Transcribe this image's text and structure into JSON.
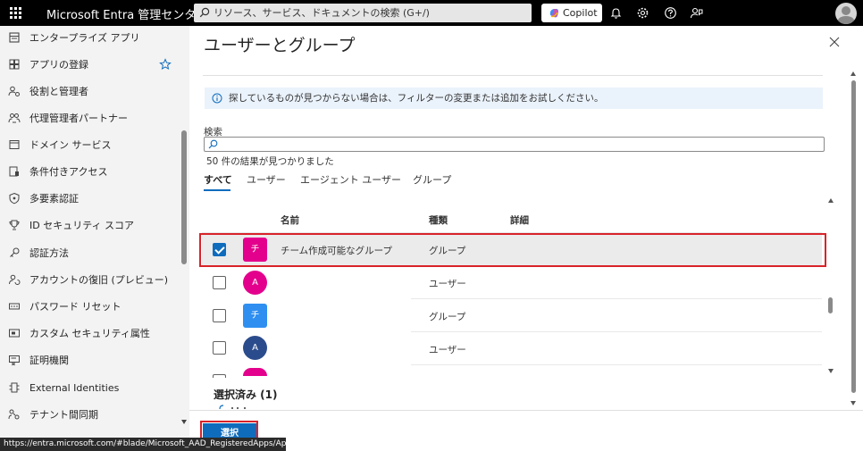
{
  "topbar": {
    "brand": "Microsoft Entra 管理センター",
    "search_placeholder": "リソース、サービス、ドキュメントの検索 (G+/)",
    "copilot_label": "Copilot"
  },
  "sidebar": {
    "items": [
      {
        "label": "エンタープライズ アプリ",
        "icon": "grid-icon"
      },
      {
        "label": "アプリの登録",
        "icon": "app-registration-icon"
      },
      {
        "label": "役割と管理者",
        "icon": "roles-icon"
      },
      {
        "label": "代理管理者パートナー",
        "icon": "partner-icon"
      },
      {
        "label": "ドメイン サービス",
        "icon": "domain-icon"
      },
      {
        "label": "条件付きアクセス",
        "icon": "conditional-access-icon"
      },
      {
        "label": "多要素認証",
        "icon": "shield-icon"
      },
      {
        "label": "ID セキュリティ スコア",
        "icon": "trophy-icon"
      },
      {
        "label": "認証方法",
        "icon": "key-icon"
      },
      {
        "label": "アカウントの復旧 (プレビュー)",
        "icon": "account-recovery-icon"
      },
      {
        "label": "パスワード リセット",
        "icon": "password-icon"
      },
      {
        "label": "カスタム セキュリティ属性",
        "icon": "attributes-icon"
      },
      {
        "label": "証明機関",
        "icon": "certificate-icon"
      },
      {
        "label": "External Identities",
        "icon": "external-identities-icon"
      },
      {
        "label": "テナント間同期",
        "icon": "sync-icon"
      }
    ]
  },
  "panel": {
    "title": "ユーザーとグループ",
    "info_text": "探しているものが見つからない場合は、フィルターの変更または追加をお試しください。",
    "search_label": "検索",
    "search_value": "",
    "result_count": "50 件の結果が見つかりました",
    "tabs": [
      {
        "label": "すべて",
        "active": true
      },
      {
        "label": "ユーザー",
        "active": false
      },
      {
        "label": "エージェント ユーザー",
        "active": false
      },
      {
        "label": "グループ",
        "active": false
      }
    ],
    "columns": [
      "名前",
      "種類",
      "詳細"
    ],
    "rows": [
      {
        "initial": "チ",
        "name": "チーム作成可能なグループ",
        "type": "グループ",
        "checked": true,
        "color": "#e3008c"
      },
      {
        "initial": "A",
        "name": "",
        "type": "ユーザー",
        "checked": false,
        "color": "#e3008c"
      },
      {
        "initial": "チ",
        "name": "",
        "type": "グループ",
        "checked": false,
        "color": "#2f8ff0"
      },
      {
        "initial": "A",
        "name": "",
        "type": "ユーザー",
        "checked": false,
        "color": "#2b4c8c"
      }
    ],
    "selected_title": "選択済み (1)",
    "select_button": "選択"
  },
  "statusbar": {
    "url": "https://entra.microsoft.com/#blade/Microsoft_AAD_RegisteredApps/Applica..."
  }
}
